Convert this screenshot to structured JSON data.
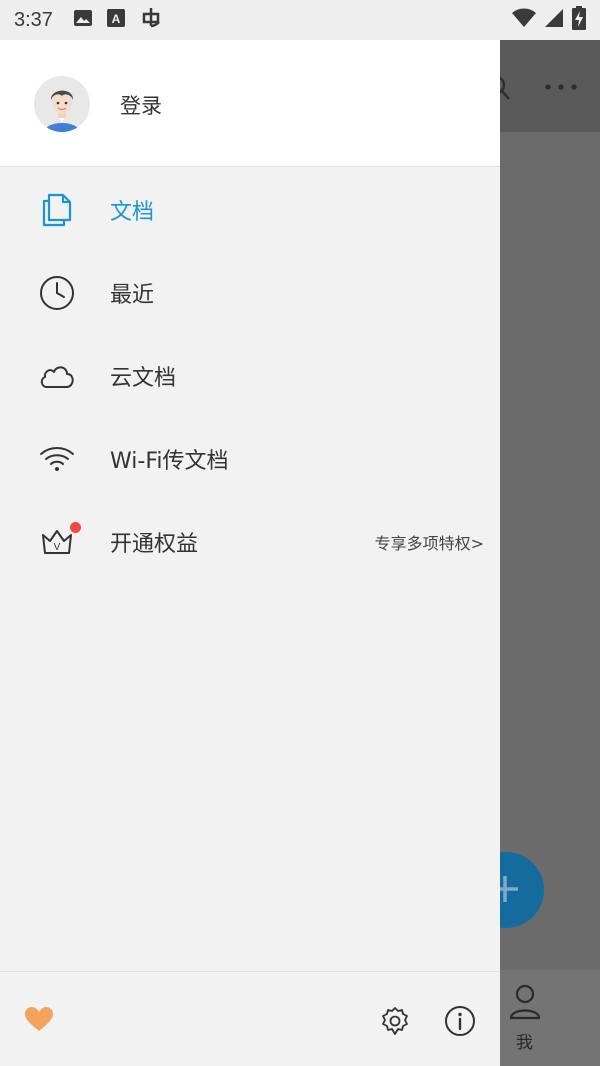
{
  "status_bar": {
    "time": "3:37",
    "icons": [
      "image-icon",
      "font-a-icon",
      "bug-icon",
      "wifi-icon",
      "signal-icon",
      "battery-charging-icon"
    ]
  },
  "drawer": {
    "header": {
      "login_label": "登录",
      "avatar_icon": "user-avatar-icon"
    },
    "items": [
      {
        "id": "documents",
        "label": "文档",
        "icon": "documents-icon",
        "active": true
      },
      {
        "id": "recent",
        "label": "最近",
        "icon": "clock-icon",
        "active": false
      },
      {
        "id": "cloud",
        "label": "云文档",
        "icon": "cloud-icon",
        "active": false
      },
      {
        "id": "wifi-transfer",
        "label": "Wi-Fi传文档",
        "icon": "wifi-icon",
        "active": false
      },
      {
        "id": "vip",
        "label": "开通权益",
        "icon": "crown-icon",
        "active": false,
        "extra": "专享多项特权>",
        "badge": "red-dot"
      }
    ],
    "footer": {
      "left_icon": "heart-icon",
      "right_icons": [
        "settings-gear-icon",
        "info-icon"
      ]
    }
  },
  "background_app": {
    "toolbar_icons": [
      "search-icon",
      "more-icon"
    ],
    "fab_icon": "plus-icon",
    "bottom_nav": {
      "me_label": "我",
      "me_icon": "person-icon"
    }
  },
  "colors": {
    "accent": "#1a95cf",
    "text": "#333333",
    "drawer_bg": "#f2f2f2",
    "heart": "#f5a25d",
    "badge": "#f24848",
    "scrim": "#6b6b6b"
  }
}
